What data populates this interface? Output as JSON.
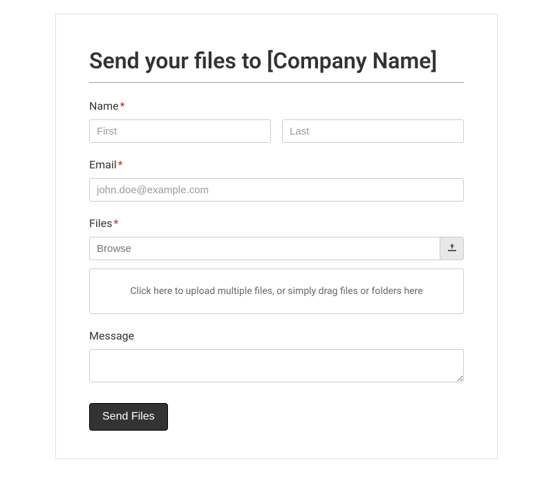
{
  "title": "Send your files to [Company Name]",
  "fields": {
    "name": {
      "label": "Name",
      "required_mark": "*",
      "first_placeholder": "First",
      "last_placeholder": "Last"
    },
    "email": {
      "label": "Email",
      "required_mark": "*",
      "placeholder": "john.doe@example.com"
    },
    "files": {
      "label": "Files",
      "required_mark": "*",
      "browse_placeholder": "Browse",
      "dropzone_text": "Click here to upload multiple files, or simply drag files or folders here"
    },
    "message": {
      "label": "Message"
    }
  },
  "submit_label": "Send Files"
}
